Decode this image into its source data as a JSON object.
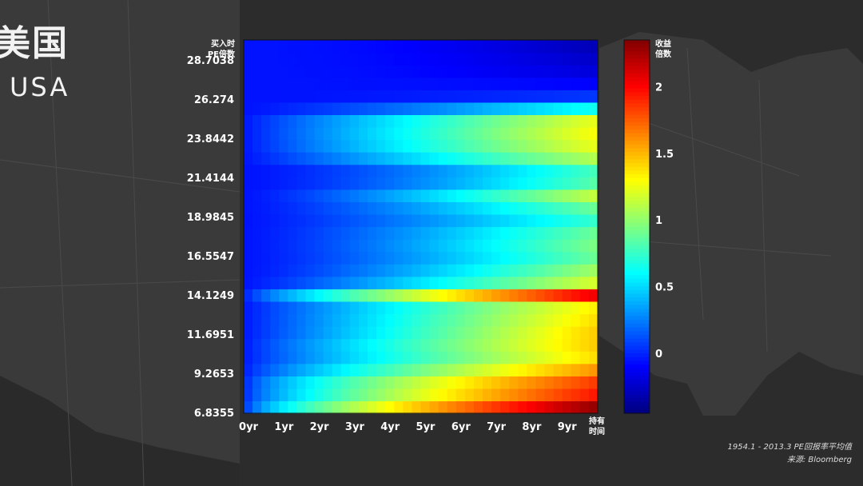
{
  "header": {
    "country_cn": "美国",
    "country_en": "USA"
  },
  "caption": {
    "period": "1954.1 - 2013.3  PE回报率平均值",
    "source": "来源: Bloomberg"
  },
  "colors": {
    "background": "#2c2c2c",
    "land": "#3a3a3a",
    "border_lines": "#4a4a4a"
  },
  "chart_data": {
    "type": "heatmap",
    "colormap": "jet",
    "y_axis_title_line1": "买入时",
    "y_axis_title_line2": "PE倍数",
    "x_axis_title_line1": "持有",
    "x_axis_title_line2": "时间",
    "colorbar_title_line1": "收益",
    "colorbar_title_line2": "倍数",
    "x_ticks": [
      "0yr",
      "1yr",
      "2yr",
      "3yr",
      "4yr",
      "5yr",
      "6yr",
      "7yr",
      "8yr",
      "9yr"
    ],
    "x_range": [
      0,
      10
    ],
    "y_ticks": [
      "28.7038",
      "26.274",
      "23.8442",
      "21.4144",
      "18.9845",
      "16.5547",
      "14.1249",
      "11.6951",
      "9.2653",
      "6.8355"
    ],
    "y_range": [
      6.8355,
      30.0
    ],
    "colorbar_ticks": [
      "2",
      "1.5",
      "1",
      "0.5",
      "0"
    ],
    "colorbar_range": [
      -0.45,
      2.35
    ],
    "grid": false,
    "rows_low_to_high_pe": [
      {
        "pe": 6.8355,
        "end": 2.3,
        "speed": 1.6
      },
      {
        "pe": 7.7,
        "end": 1.95,
        "speed": 1.5
      },
      {
        "pe": 8.4,
        "end": 1.85,
        "speed": 1.5
      },
      {
        "pe": 9.2653,
        "end": 1.6,
        "speed": 1.3
      },
      {
        "pe": 10.0,
        "end": 1.4,
        "speed": 1.2
      },
      {
        "pe": 10.8,
        "end": 1.45,
        "speed": 1.2
      },
      {
        "pe": 11.6951,
        "end": 1.45,
        "speed": 1.1
      },
      {
        "pe": 12.5,
        "end": 1.4,
        "speed": 1.1
      },
      {
        "pe": 13.3,
        "end": 1.35,
        "speed": 1.1
      },
      {
        "pe": 14.1249,
        "end": 2.05,
        "speed": 1.3
      },
      {
        "pe": 14.9,
        "end": 1.2,
        "speed": 0.9
      },
      {
        "pe": 15.7,
        "end": 1.05,
        "speed": 0.8
      },
      {
        "pe": 16.5547,
        "end": 0.9,
        "speed": 0.8
      },
      {
        "pe": 17.3,
        "end": 0.95,
        "speed": 0.8
      },
      {
        "pe": 18.1,
        "end": 0.9,
        "speed": 0.8
      },
      {
        "pe": 18.9845,
        "end": 0.75,
        "speed": 0.8
      },
      {
        "pe": 19.8,
        "end": 0.9,
        "speed": 0.8
      },
      {
        "pe": 20.6,
        "end": 1.15,
        "speed": 0.8
      },
      {
        "pe": 21.4144,
        "end": 0.85,
        "speed": 0.7
      },
      {
        "pe": 22.2,
        "end": 0.8,
        "speed": 0.7
      },
      {
        "pe": 23.0,
        "end": 1.1,
        "speed": 1.0
      },
      {
        "pe": 23.8442,
        "end": 1.25,
        "speed": 1.1
      },
      {
        "pe": 24.6,
        "end": 1.3,
        "speed": 1.1
      },
      {
        "pe": 25.5,
        "end": 1.25,
        "speed": 1.1
      },
      {
        "pe": 26.274,
        "end": 0.65,
        "speed": 0.8
      },
      {
        "pe": 27.1,
        "end": 0.05,
        "speed": 0.5
      },
      {
        "pe": 27.9,
        "end": -0.1,
        "speed": 0.5
      },
      {
        "pe": 28.7038,
        "end": -0.2,
        "speed": 0.5
      },
      {
        "pe": 29.4,
        "end": -0.25,
        "speed": 0.5
      },
      {
        "pe": 30.0,
        "end": -0.3,
        "speed": 0.5
      }
    ],
    "start_value": -0.05
  }
}
